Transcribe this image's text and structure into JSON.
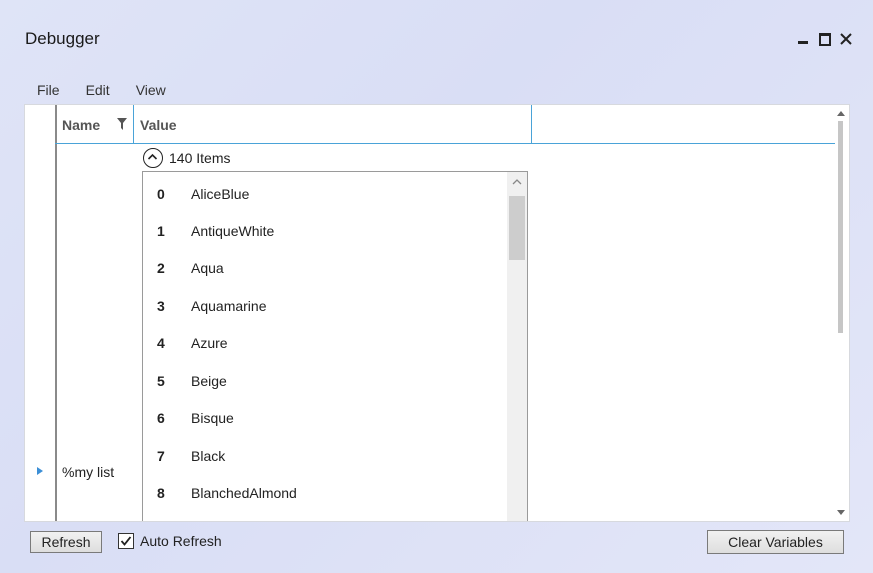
{
  "window": {
    "title": "Debugger",
    "controls": [
      "minimize-icon",
      "maximize-icon",
      "close-icon"
    ]
  },
  "menu": {
    "items": [
      "File",
      "Edit",
      "View"
    ]
  },
  "grid": {
    "columns": {
      "name": "Name",
      "value": "Value"
    },
    "row": {
      "name": "%my list",
      "items_label": "140 Items",
      "list": [
        {
          "index": "0",
          "value": "AliceBlue"
        },
        {
          "index": "1",
          "value": "AntiqueWhite"
        },
        {
          "index": "2",
          "value": "Aqua"
        },
        {
          "index": "3",
          "value": "Aquamarine"
        },
        {
          "index": "4",
          "value": "Azure"
        },
        {
          "index": "5",
          "value": "Beige"
        },
        {
          "index": "6",
          "value": "Bisque"
        },
        {
          "index": "7",
          "value": "Black"
        },
        {
          "index": "8",
          "value": "BlanchedAlmond"
        }
      ]
    }
  },
  "footer": {
    "refresh_label": "Refresh",
    "auto_refresh_label": "Auto Refresh",
    "auto_refresh_checked": true,
    "clear_label": "Clear Variables"
  },
  "colors": {
    "accent": "#4aa3d8",
    "row_arrow": "#3c8fd6"
  }
}
